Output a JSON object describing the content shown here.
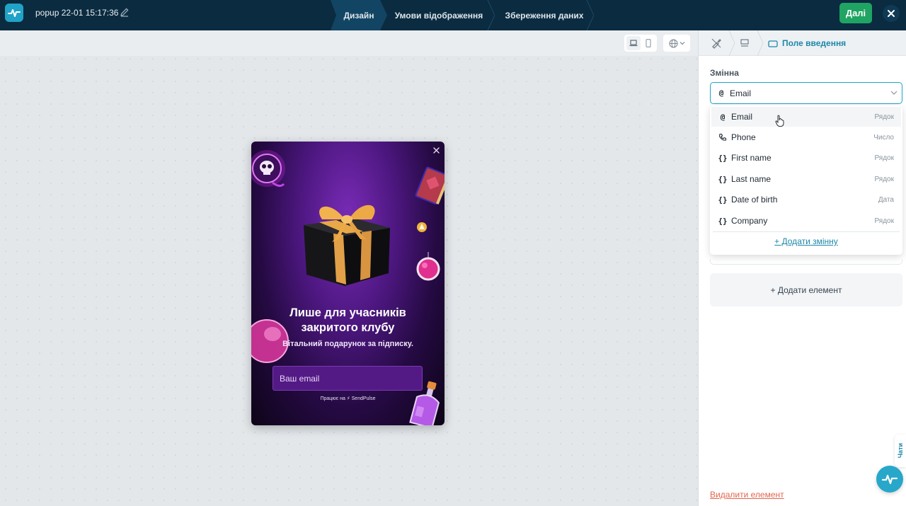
{
  "header": {
    "popup_title": "popup 22-01 15:17:36",
    "steps": [
      {
        "label": "Дизайн",
        "active": true
      },
      {
        "label": "Умови відображення",
        "active": false
      },
      {
        "label": "Збереження даних",
        "active": false
      }
    ],
    "next_label": "Далі"
  },
  "popup": {
    "heading_line1": "Лише для учасників",
    "heading_line2": "закритого клубу",
    "subtitle": "Вітальний подарунок за підписку.",
    "email_placeholder": "Ваш email",
    "powered_by": "Працює на ⚡ SendPulse"
  },
  "panel": {
    "breadcrumb_title": "Поле введення",
    "variable_label": "Змінна",
    "selected_value": "Email",
    "options": [
      {
        "icon": "at-icon",
        "label": "Email",
        "type": "Рядок"
      },
      {
        "icon": "phone-icon",
        "label": "Phone",
        "type": "Число"
      },
      {
        "icon": "braces-icon",
        "label": "First name",
        "type": "Рядок"
      },
      {
        "icon": "braces-icon",
        "label": "Last name",
        "type": "Рядок"
      },
      {
        "icon": "braces-icon",
        "label": "Date of birth",
        "type": "Дата"
      },
      {
        "icon": "braces-icon",
        "label": "Company",
        "type": "Рядок"
      }
    ],
    "add_variable": "+ Додати змінну",
    "add_element": "+ Додати елемент",
    "delete_element": "Видалити елемент",
    "chat_tab": "Чати"
  },
  "colors": {
    "topbar": "#0b2b40",
    "accent": "#20a3c6",
    "next_button": "#1fa463",
    "delete": "#e2664f"
  }
}
